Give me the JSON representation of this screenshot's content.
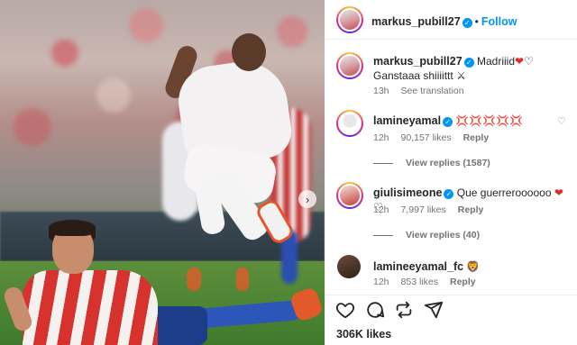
{
  "post": {
    "author": "markus_pubill27",
    "follow_label": "Follow",
    "likes_text": "306K likes"
  },
  "caption": {
    "author": "markus_pubill27",
    "text_line1": "Madriiid",
    "text_line2": "Ganstaaa shiiiittt",
    "time": "13h",
    "see_translation": "See translation"
  },
  "comments": [
    {
      "author": "lamineyamal",
      "text": "💢💢💢💢💢",
      "time": "12h",
      "likes": "90,157 likes",
      "reply": "Reply",
      "view_replies": "View replies (1587)"
    },
    {
      "author": "giulisimeone",
      "text": "Que guerreroooooo",
      "time": "12h",
      "likes": "7,997 likes",
      "reply": "Reply",
      "view_replies": "View replies (40)"
    },
    {
      "author": "lamineeyamal_fc",
      "text": "🦁",
      "time": "12h",
      "likes": "853 likes",
      "reply": "Reply"
    }
  ],
  "icons": {
    "like": "heart-icon",
    "comment": "comment-icon",
    "repost": "repost-icon",
    "share": "share-icon",
    "next": "chevron-right-icon",
    "verified": "verified-badge-icon"
  },
  "colors": {
    "accent": "#0095f6",
    "heart": "#e02b2b",
    "muted": "#737373"
  }
}
